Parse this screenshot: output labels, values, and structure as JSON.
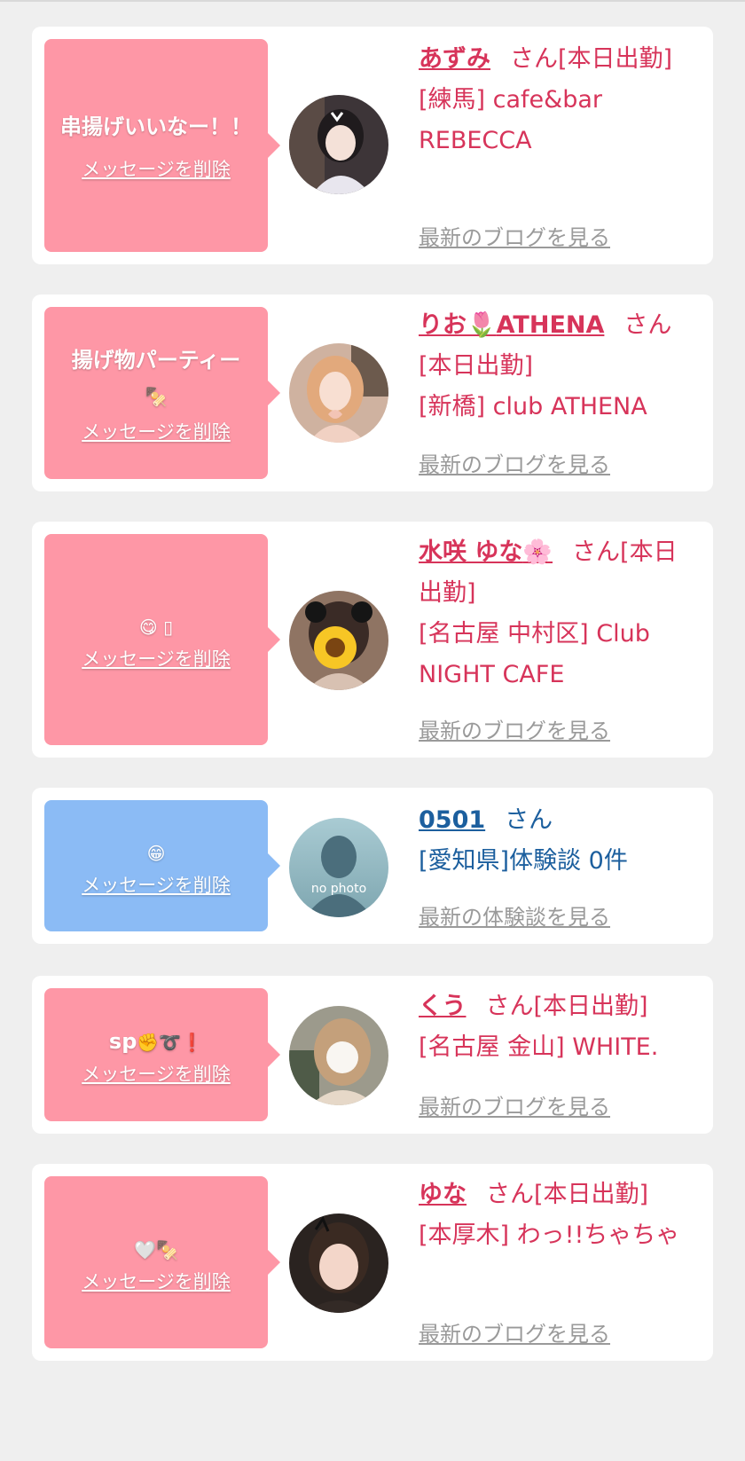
{
  "delete_label": "メッセージを削除",
  "cards": [
    {
      "message": "串揚げいいなー！！",
      "message_emoji": "",
      "name": "あずみ",
      "name_emoji": "",
      "suffix": "さん[本日出勤]",
      "shop": "[練馬] cafe&bar REBECCA",
      "link": "最新のブログを見る"
    },
    {
      "message": "揚げ物パーティー",
      "message_emoji": "🍢",
      "name": "りお",
      "name_emoji": "🌷",
      "name_tail": "ATHENA",
      "suffix": "さん[本日出勤]",
      "shop": "[新橋] club ATHENA",
      "link": "最新のブログを見る"
    },
    {
      "message": "",
      "message_emoji": "😋 ▯",
      "name": "水咲 ゆな",
      "name_emoji": "🌸",
      "suffix": "さん[本日出勤]",
      "shop": "[名古屋 中村区] Club NIGHT CAFE",
      "link": "最新のブログを見る"
    },
    {
      "message": "",
      "message_emoji": "😁",
      "name": "0501",
      "name_emoji": "",
      "suffix": "さん",
      "shop": "[愛知県]体験談 0件",
      "link": "最新の体験談を見る",
      "avatar_text": "no photo"
    },
    {
      "message": "sp",
      "message_emoji": "✊➰❗",
      "name": "くう",
      "name_emoji": "",
      "suffix": "さん[本日出勤]",
      "shop": "[名古屋 金山] WHITE.",
      "link": "最新のブログを見る"
    },
    {
      "message": "",
      "message_emoji": "🤍🍢",
      "name": "ゆな",
      "name_emoji": "",
      "suffix": "さん[本日出勤]",
      "shop": "[本厚木] わっ!!ちゃちゃ",
      "link": "最新のブログを見る"
    }
  ],
  "colors": {
    "page_bg": "#efefef",
    "bubble_pink": "#fe97a6",
    "bubble_blue": "#8bbbf5",
    "text_pink": "#d7345a",
    "text_blue": "#1c5f9e",
    "link_gray": "#9a9a9a"
  }
}
